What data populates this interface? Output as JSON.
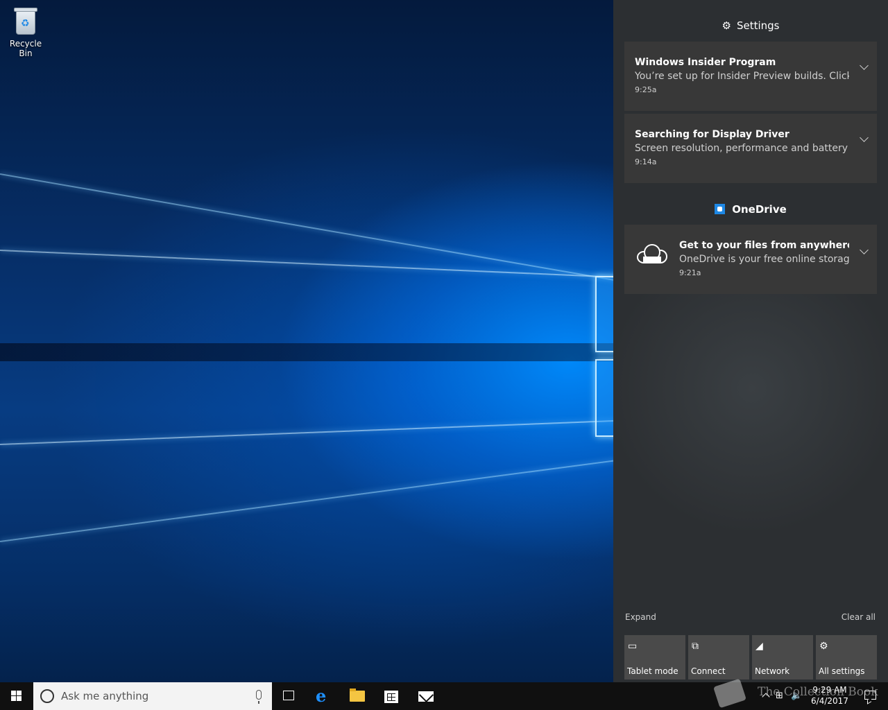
{
  "desktop": {
    "recycle_bin_label": "Recycle Bin"
  },
  "action_center": {
    "header": {
      "icon": "gear-icon",
      "title": "Settings"
    },
    "notifications_settings": [
      {
        "title": "Windows Insider Program",
        "body": "You’re set up for Insider Preview builds. Click to",
        "time": "9:25a"
      },
      {
        "title": "Searching for Display Driver",
        "body": "Screen resolution, performance and battery life",
        "time": "9:14a"
      }
    ],
    "onedrive_group": {
      "icon": "onedrive-icon",
      "title": "OneDrive",
      "notification": {
        "icon": "cloud-icon",
        "title": "Get to your files from anywhere",
        "body": "OneDrive is your free online storage.",
        "time": "9:21a"
      }
    },
    "expand_label": "Expand",
    "clear_all_label": "Clear all",
    "quick_actions": [
      {
        "icon": "tablet-mode-icon",
        "label": "Tablet mode"
      },
      {
        "icon": "connect-icon",
        "label": "Connect"
      },
      {
        "icon": "network-icon",
        "label": "Network"
      },
      {
        "icon": "gear-icon",
        "label": "All settings"
      }
    ]
  },
  "taskbar": {
    "search_placeholder": "Ask me anything",
    "pinned": [
      "task-view-icon",
      "edge-icon",
      "file-explorer-icon",
      "store-icon",
      "mail-icon"
    ],
    "clock": {
      "time": "9:29 AM",
      "date": "6/4/2017"
    }
  },
  "watermark": {
    "text": "The Collection Book"
  },
  "colors": {
    "action_center_bg": "#2b2b2b",
    "notification_bg": "#383838",
    "tile_bg": "#4a4a4a",
    "taskbar_bg": "#101010",
    "accent": "#1e88e5"
  }
}
